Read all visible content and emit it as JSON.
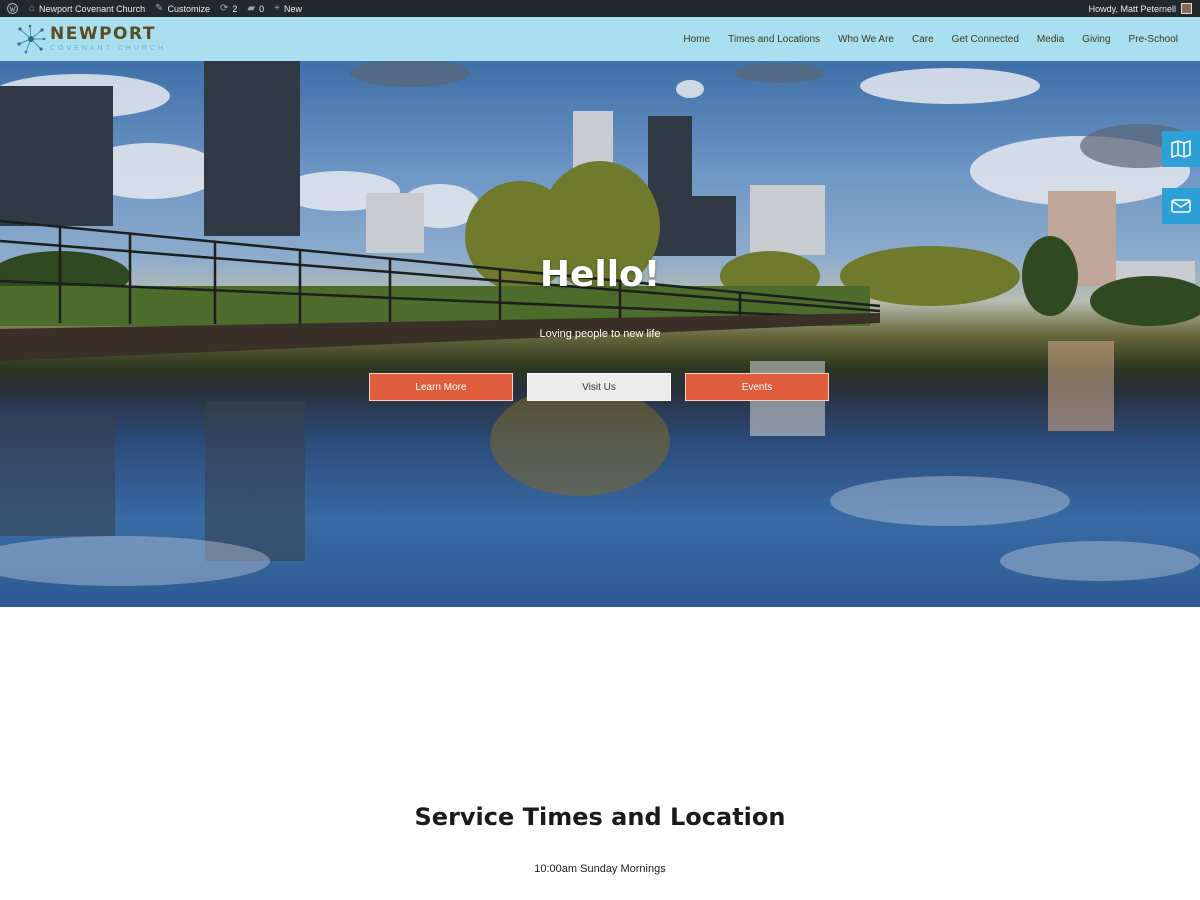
{
  "admin_bar": {
    "site_name": "Newport Covenant Church",
    "customize": "Customize",
    "updates_count": "2",
    "comments_count": "0",
    "new_label": "New",
    "howdy": "Howdy, Matt Peternell"
  },
  "header": {
    "logo_title": "NEWPORT",
    "logo_subtitle": "COVENANT CHURCH",
    "nav": [
      "Home",
      "Times and Locations",
      "Who We Are",
      "Care",
      "Get Connected",
      "Media",
      "Giving",
      "Pre-School"
    ]
  },
  "hero": {
    "title": "Hello!",
    "subtitle": "Loving people to new life",
    "buttons": [
      "Learn More",
      "Visit Us",
      "Events"
    ]
  },
  "side_tabs": [
    "map-icon",
    "mail-icon"
  ],
  "section": {
    "title": "Service Times and Location",
    "text": "10:00am Sunday Mornings"
  },
  "colors": {
    "admin_bar": "#23282d",
    "header_bg": "#a9dfee",
    "accent_orange": "#df5c3c",
    "side_tab_blue": "#2ea0d8"
  }
}
